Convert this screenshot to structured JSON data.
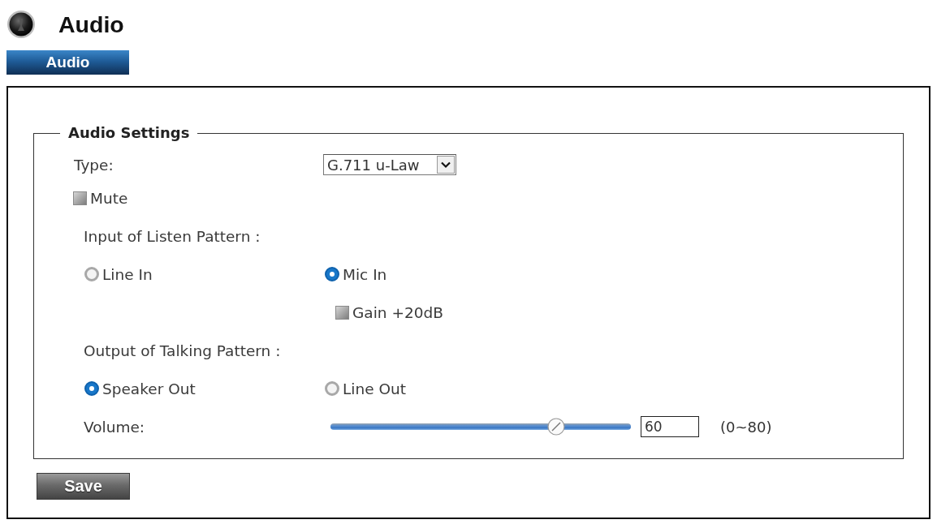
{
  "header": {
    "title": "Audio"
  },
  "tabs": [
    {
      "label": "Audio",
      "selected": true
    }
  ],
  "panel": {
    "legend": "Audio Settings",
    "type": {
      "label": "Type:",
      "value": "G.711 u-Law"
    },
    "mute": {
      "label": "Mute",
      "checked": false
    },
    "input": {
      "label": "Input of Listen Pattern :",
      "options": [
        {
          "label": "Line In",
          "selected": false
        },
        {
          "label": "Mic In",
          "selected": true
        }
      ],
      "gain": {
        "label": "Gain +20dB",
        "checked": false
      }
    },
    "output": {
      "label": "Output of Talking Pattern :",
      "options": [
        {
          "label": "Speaker Out",
          "selected": true
        },
        {
          "label": "Line Out",
          "selected": false
        }
      ]
    },
    "volume": {
      "label": "Volume:",
      "level": 0.75,
      "value": "60",
      "range": "(0~80)"
    }
  },
  "buttons": [
    {
      "label": "Save"
    }
  ]
}
